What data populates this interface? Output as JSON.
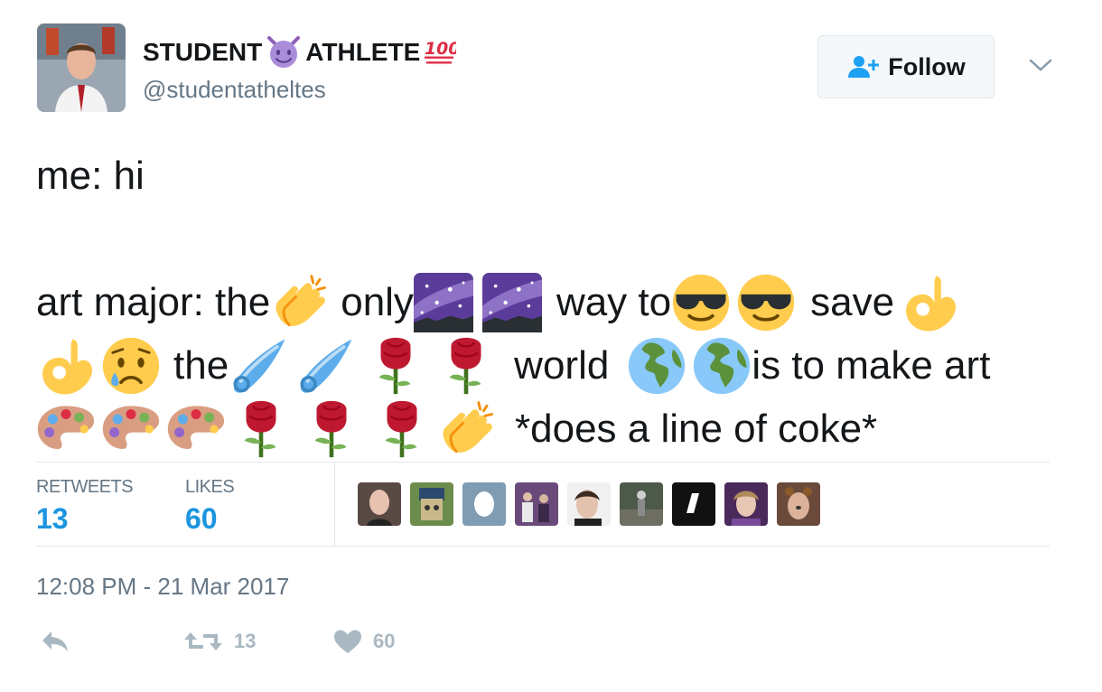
{
  "author": {
    "display_name_part1": "STUDENT",
    "display_name_part2": "ATHLETE",
    "handle": "@studentatheltes",
    "avatar_icon": "profile-photo",
    "name_icons": [
      "smiling-imp-icon",
      "hundred-points-icon"
    ]
  },
  "follow_button": {
    "label": "Follow",
    "icon": "add-user-icon"
  },
  "menu": {
    "icon": "chevron-down-icon"
  },
  "tweet": {
    "line1": "me: hi",
    "line2_texts": [
      "art major: the",
      "only",
      "way to",
      "save"
    ],
    "line3_texts": [
      "the",
      "world",
      "is to make art"
    ],
    "line4_texts": [
      "*does a line of coke*"
    ],
    "emoji_sequence": [
      "clapping-hands",
      "milky-way",
      "milky-way",
      "smiling-face-with-sunglasses",
      "smiling-face-with-sunglasses",
      "ok-hand",
      "ok-hand",
      "sad-but-relieved-face",
      "comet",
      "comet",
      "rose",
      "rose",
      "globe-africa",
      "globe-africa",
      "artist-palette",
      "artist-palette",
      "artist-palette",
      "rose",
      "rose",
      "rose",
      "clapping-hands"
    ]
  },
  "stats": {
    "retweets_label": "RETWEETS",
    "retweets_value": "13",
    "likes_label": "LIKES",
    "likes_value": "60"
  },
  "likers": [
    "liker-avatar-1",
    "liker-avatar-2",
    "liker-avatar-3",
    "liker-avatar-4",
    "liker-avatar-5",
    "liker-avatar-6",
    "liker-avatar-7",
    "liker-avatar-8",
    "liker-avatar-9"
  ],
  "timestamp": "12:08 PM - 21 Mar 2017",
  "actions": {
    "reply_icon": "reply-icon",
    "retweet_icon": "retweet-icon",
    "retweet_count": "13",
    "like_icon": "heart-icon",
    "like_count": "60"
  },
  "colors": {
    "link_blue": "#1b95e0",
    "secondary_gray": "#657786",
    "border": "#e1e8ed",
    "action_gray": "#aab8c2"
  }
}
